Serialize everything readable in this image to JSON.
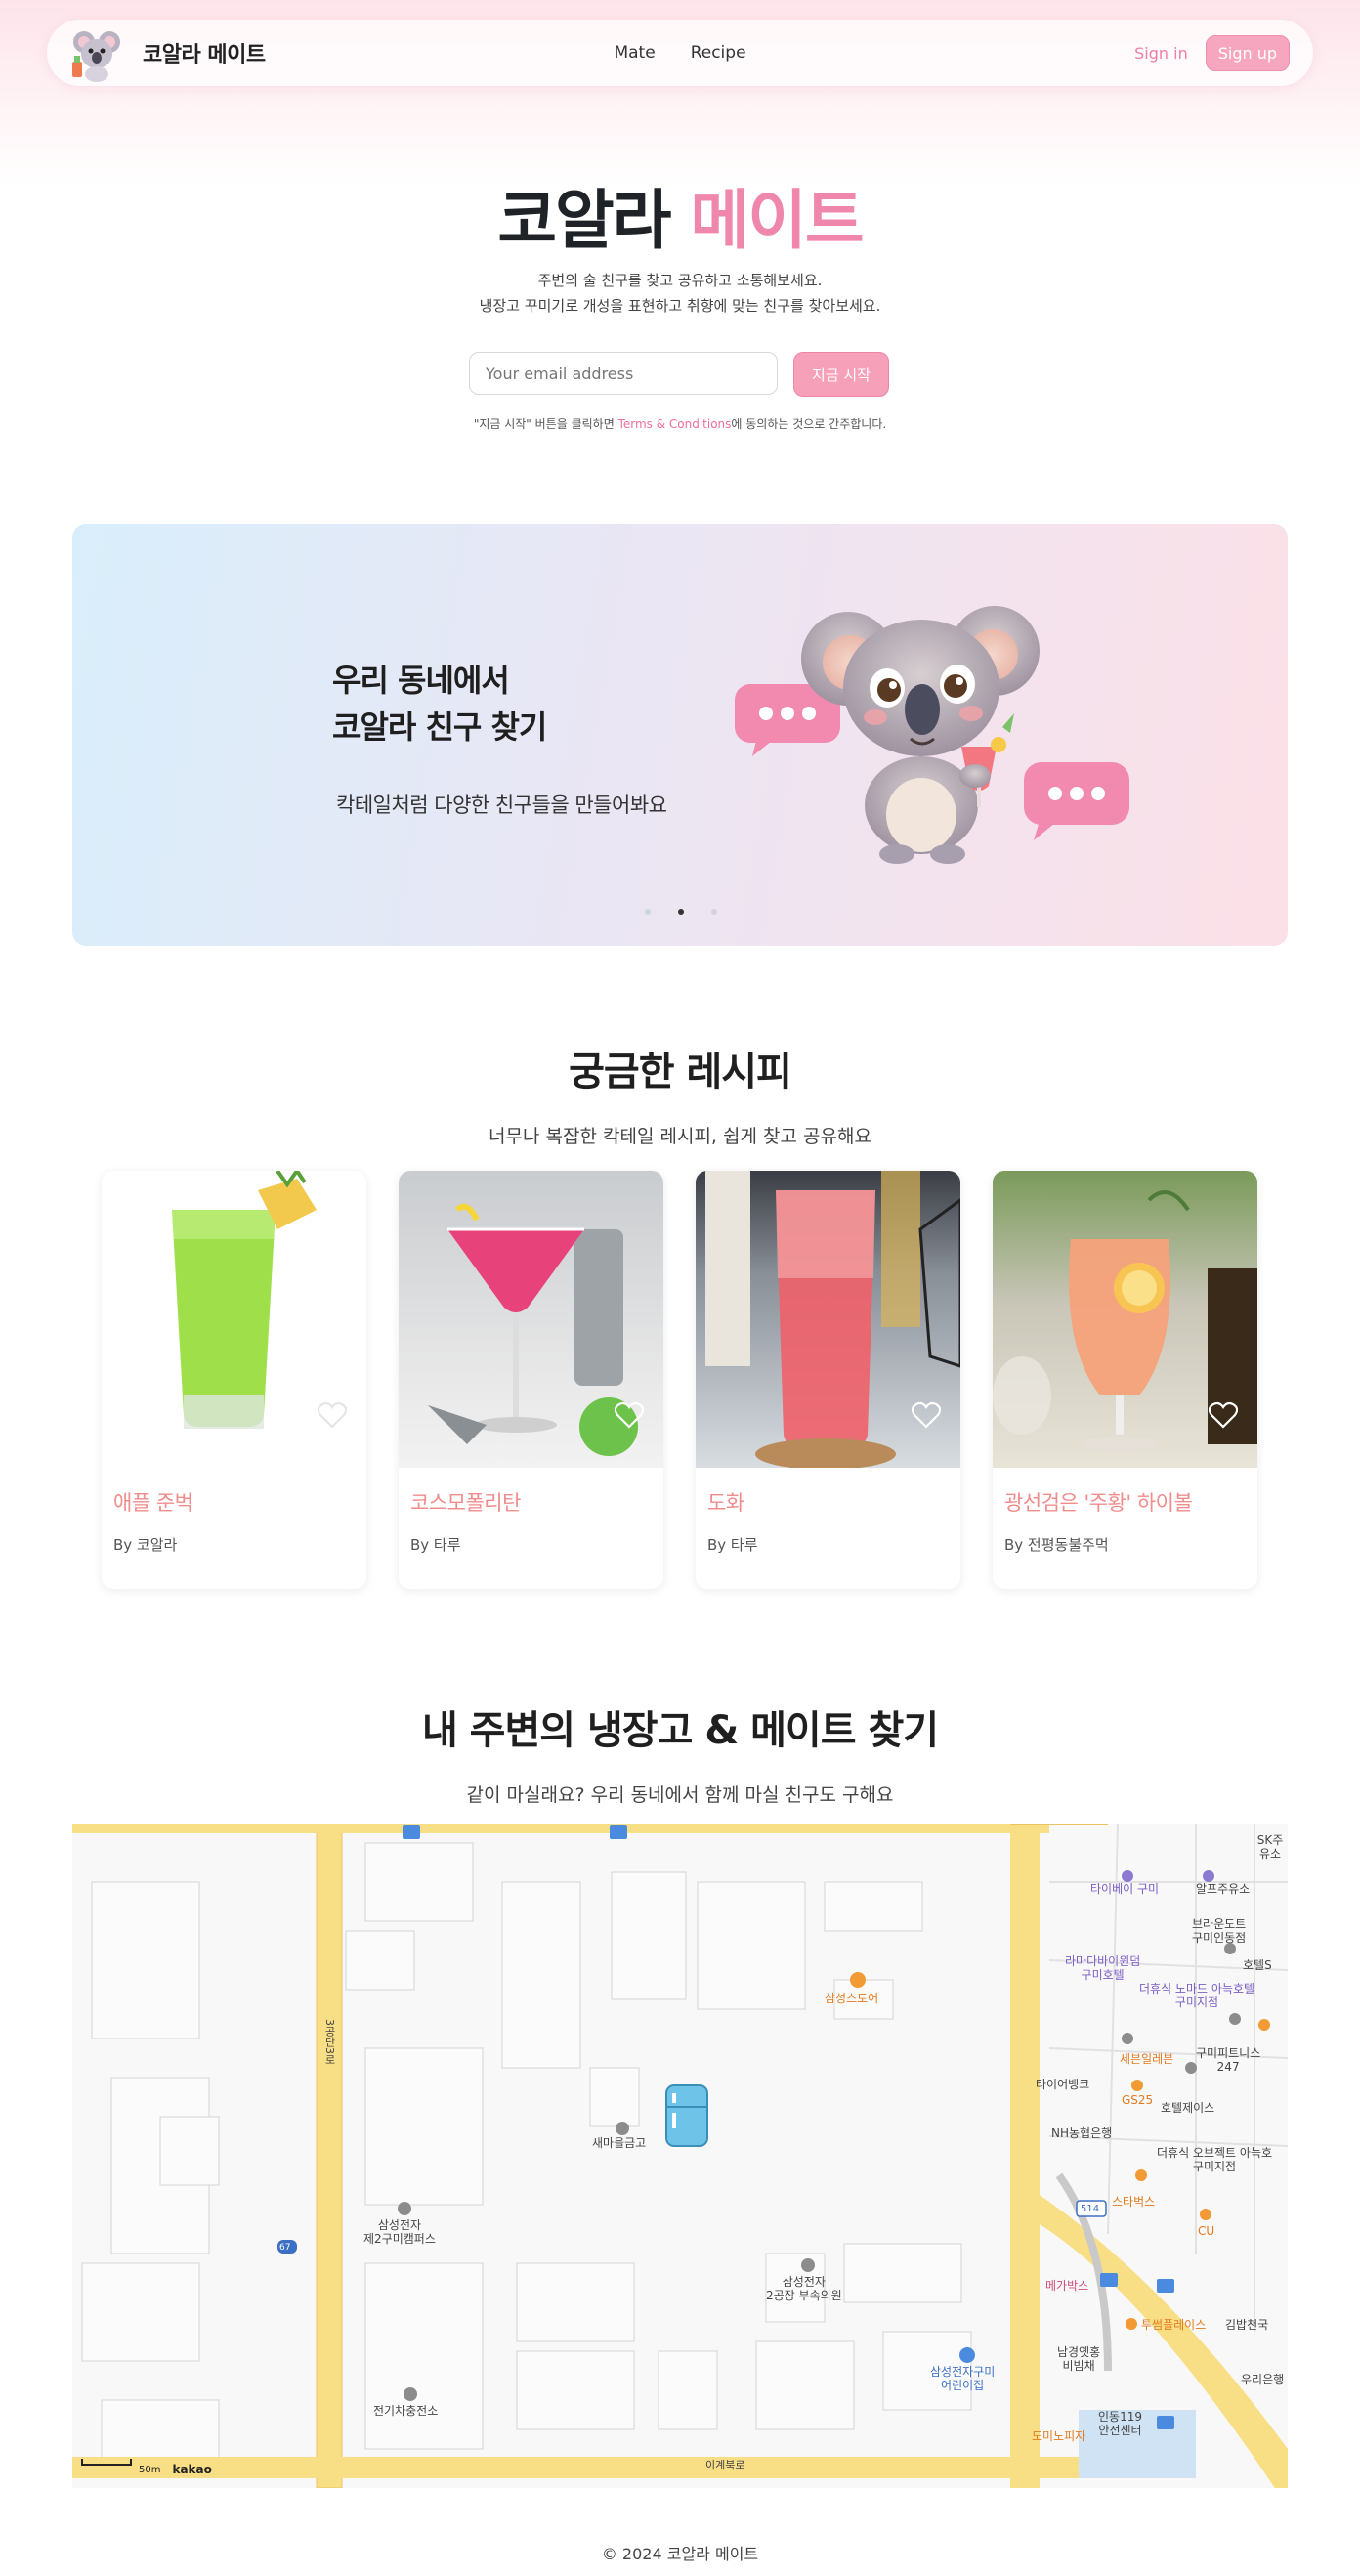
{
  "brand": {
    "name": "코알라 메이트"
  },
  "nav": {
    "links": [
      "Mate",
      "Recipe"
    ],
    "sign_in": "Sign in",
    "sign_up": "Sign up"
  },
  "hero": {
    "title_part1": "코알라",
    "title_part2": "메이트",
    "desc_line1": "주변의 술 친구를 찾고 공유하고 소통해보세요.",
    "desc_line2": "냉장고 꾸미기로 개성을 표현하고 취향에 맞는 친구를 찾아보세요.",
    "email_placeholder": "Your email address",
    "start_button": "지금 시작",
    "terms_prefix": "\"지금 시작\" 버튼을 클릭하면 ",
    "terms_link": "Terms & Conditions",
    "terms_suffix": "에 동의하는 것으로 간주합니다."
  },
  "banner": {
    "heading_line1": "우리 동네에서",
    "heading_line2": "코알라 친구 찾기",
    "subtext": "칵테일처럼 다양한 친구들을 만들어봐요",
    "slide_count": 3,
    "active_slide": 2
  },
  "recipes": {
    "title": "궁금한 레시피",
    "subtitle": "너무나 복잡한 칵테일 레시피, 쉽게 찾고 공유해요",
    "items": [
      {
        "title": "애플 준벅",
        "author": "By 코알라"
      },
      {
        "title": "코스모폴리탄",
        "author": "By 타루"
      },
      {
        "title": "도화",
        "author": "By 타루"
      },
      {
        "title": "광선검은 '주황' 하이볼",
        "author": "By 전평동불주먹"
      }
    ]
  },
  "nearby": {
    "title": "내 주변의 냉장고 & 메이트 찾기",
    "subtitle": "같이 마실래요? 우리 동네에서 함께 마실 친구도 구해요",
    "map_labels": {
      "samsung_store": "삼성스토어",
      "saemaeul": "새마을금고",
      "campus_line1": "삼성전자",
      "campus_line2": "제2구미캠퍼스",
      "plant_line1": "삼성전자",
      "plant_line2": "2공장 부속의원",
      "electric": "전기차충전소",
      "daycare_line1": "삼성전자구미",
      "daycare_line2": "어린이집",
      "road_3": "3공단3로",
      "road_ige": "이계북로",
      "taipei": "타이베이 구미",
      "alps": "알프주유소",
      "brown_line1": "브라운도트",
      "brown_line2": "구미인동점",
      "ramada_line1": "라마다바이윈덤",
      "ramada_line2": "구미호텔",
      "nomad_line1": "더휴식 노마드 아늑호텔",
      "nomad_line2": "구미지점",
      "hotel_s": "호텔S",
      "seven": "세븐일레븐",
      "gumi_fit_line1": "구미피트니스",
      "gumi_fit_line2": "247",
      "taiyi": "타이어뱅크",
      "gs25": "GS25",
      "hotel_j": "호텔제이스",
      "nh": "NH농협은행",
      "object_line1": "더휴식 오브젝트 아늑호",
      "object_line2": "구미지점",
      "starbucks": "스타벅스",
      "cu": "CU",
      "megabox": "메가박스",
      "twosome": "투썸플레이스",
      "kimbap": "김밥천국",
      "namgyeong_line1": "남경옛홍",
      "namgyeong_line2": "비빔채",
      "woori": "우리은행",
      "domino": "도미노피자",
      "indong_line1": "인동119",
      "indong_line2": "안전센터",
      "sk": "SK주유소",
      "route": "514",
      "route67": "67",
      "scale": "50m",
      "kakao": "kakao"
    }
  },
  "footer": {
    "text": "© 2024 코알라 메이트"
  },
  "colors": {
    "accent_pink": "#ef86ab",
    "button_pink": "#f6a0ba",
    "recipe_title": "#f08c8c"
  }
}
